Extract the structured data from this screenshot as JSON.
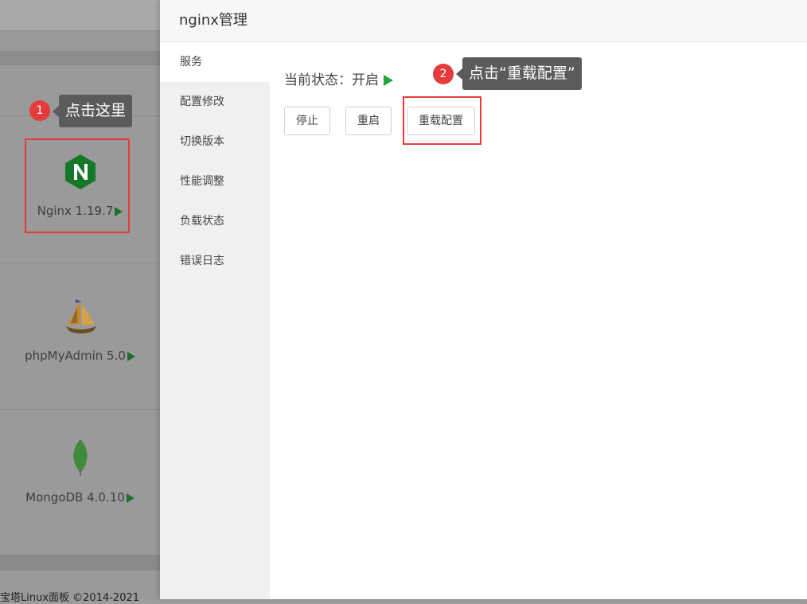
{
  "background": {
    "apps": [
      {
        "name": "Nginx 1.19.7"
      },
      {
        "name": "phpMyAdmin 5.0"
      },
      {
        "name": "MongoDB 4.0.10"
      }
    ],
    "footer_text": "宝塔Linux面板 ©2014-2021"
  },
  "annotations": {
    "step1": {
      "number": "1",
      "text": "点击这里"
    },
    "step2": {
      "number": "2",
      "text": "点击“重载配置”"
    }
  },
  "modal": {
    "title": "nginx管理",
    "menu": [
      {
        "label": "服务",
        "active": true
      },
      {
        "label": "配置修改"
      },
      {
        "label": "切换版本"
      },
      {
        "label": "性能调整"
      },
      {
        "label": "负载状态"
      },
      {
        "label": "错误日志"
      }
    ],
    "status_label": "当前状态：开启",
    "buttons": {
      "stop": "停止",
      "restart": "重启",
      "reload": "重载配置"
    }
  },
  "colors": {
    "running": "#20a53a",
    "highlight": "#e33b3b",
    "nginx_green": "#009639"
  }
}
